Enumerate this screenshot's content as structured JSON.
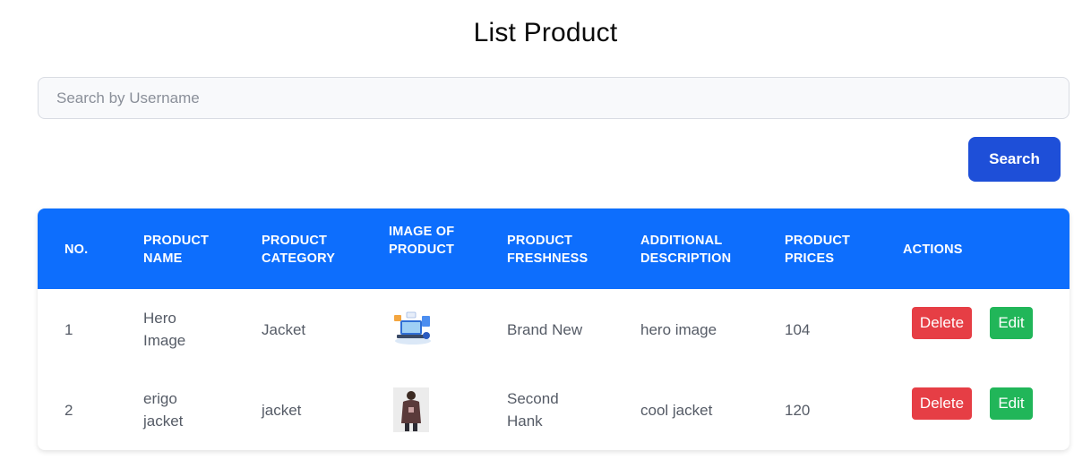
{
  "page": {
    "title": "List Product"
  },
  "search": {
    "placeholder": "Search by Username",
    "value": "",
    "button_label": "Search"
  },
  "table": {
    "headers": [
      "NO.",
      "PRODUCT NAME",
      "PRODUCT CATEGORY",
      "IMAGE OF PRODUCT",
      "PRODUCT FRESHNESS",
      "ADDITIONAL DESCRIPTION",
      "PRODUCT PRICES",
      "ACTIONS"
    ],
    "rows": [
      {
        "no": "1",
        "name": "Hero Image",
        "category": "Jacket",
        "image": "hero-illustration-icon",
        "freshness": "Brand New",
        "description": "hero image",
        "price": "104"
      },
      {
        "no": "2",
        "name": "erigo jacket",
        "category": "jacket",
        "image": "jacket-photo-icon",
        "freshness": "Second Hank",
        "description": "cool jacket",
        "price": "120"
      }
    ],
    "actions": {
      "delete_label": "Delete",
      "edit_label": "Edit"
    }
  },
  "colors": {
    "header": "#0d6efd",
    "search_button": "#1e4fd8",
    "delete": "#e63e45",
    "edit": "#21b659"
  }
}
